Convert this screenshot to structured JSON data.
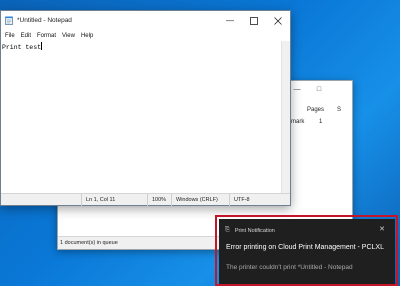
{
  "queue_window": {
    "columns": [
      "Pages",
      "S"
    ],
    "row": {
      "name_fragment": "mark",
      "pages": "1"
    },
    "status": "1 document(s) in queue"
  },
  "notepad": {
    "title": "*Untitled - Notepad",
    "menu": [
      "File",
      "Edit",
      "Format",
      "View",
      "Help"
    ],
    "content": "Print test",
    "status": {
      "position": "Ln 1, Col 11",
      "zoom": "100%",
      "line_ending": "Windows (CRLF)",
      "encoding": "UTF-8"
    }
  },
  "toast": {
    "header": "Print Notification",
    "title": "Error printing on Cloud Print Management - PCLXL",
    "message": "The printer couldn't print *Untitled - Notepad",
    "outline_color": "#c4162b"
  }
}
